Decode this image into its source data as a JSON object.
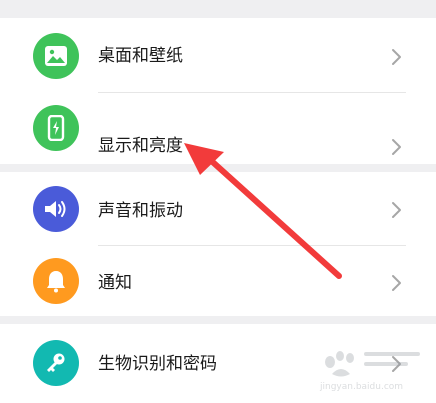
{
  "items": [
    {
      "label": "桌面和壁纸",
      "icon": "wallpaper-image-icon",
      "color": "#3fc35a"
    },
    {
      "label": "显示和亮度",
      "icon": "phone-brightness-icon",
      "color": "#3fc35a"
    },
    {
      "label": "声音和振动",
      "icon": "speaker-volume-icon",
      "color": "#4a5bd9"
    },
    {
      "label": "通知",
      "icon": "bell-icon",
      "color": "#ff9a1f"
    },
    {
      "label": "生物识别和密码",
      "icon": "key-icon",
      "color": "#12b9b1"
    }
  ],
  "annotation": {
    "arrow_color": "#f23b3b"
  },
  "watermark": {
    "url": "jingyan.baidu.com"
  }
}
